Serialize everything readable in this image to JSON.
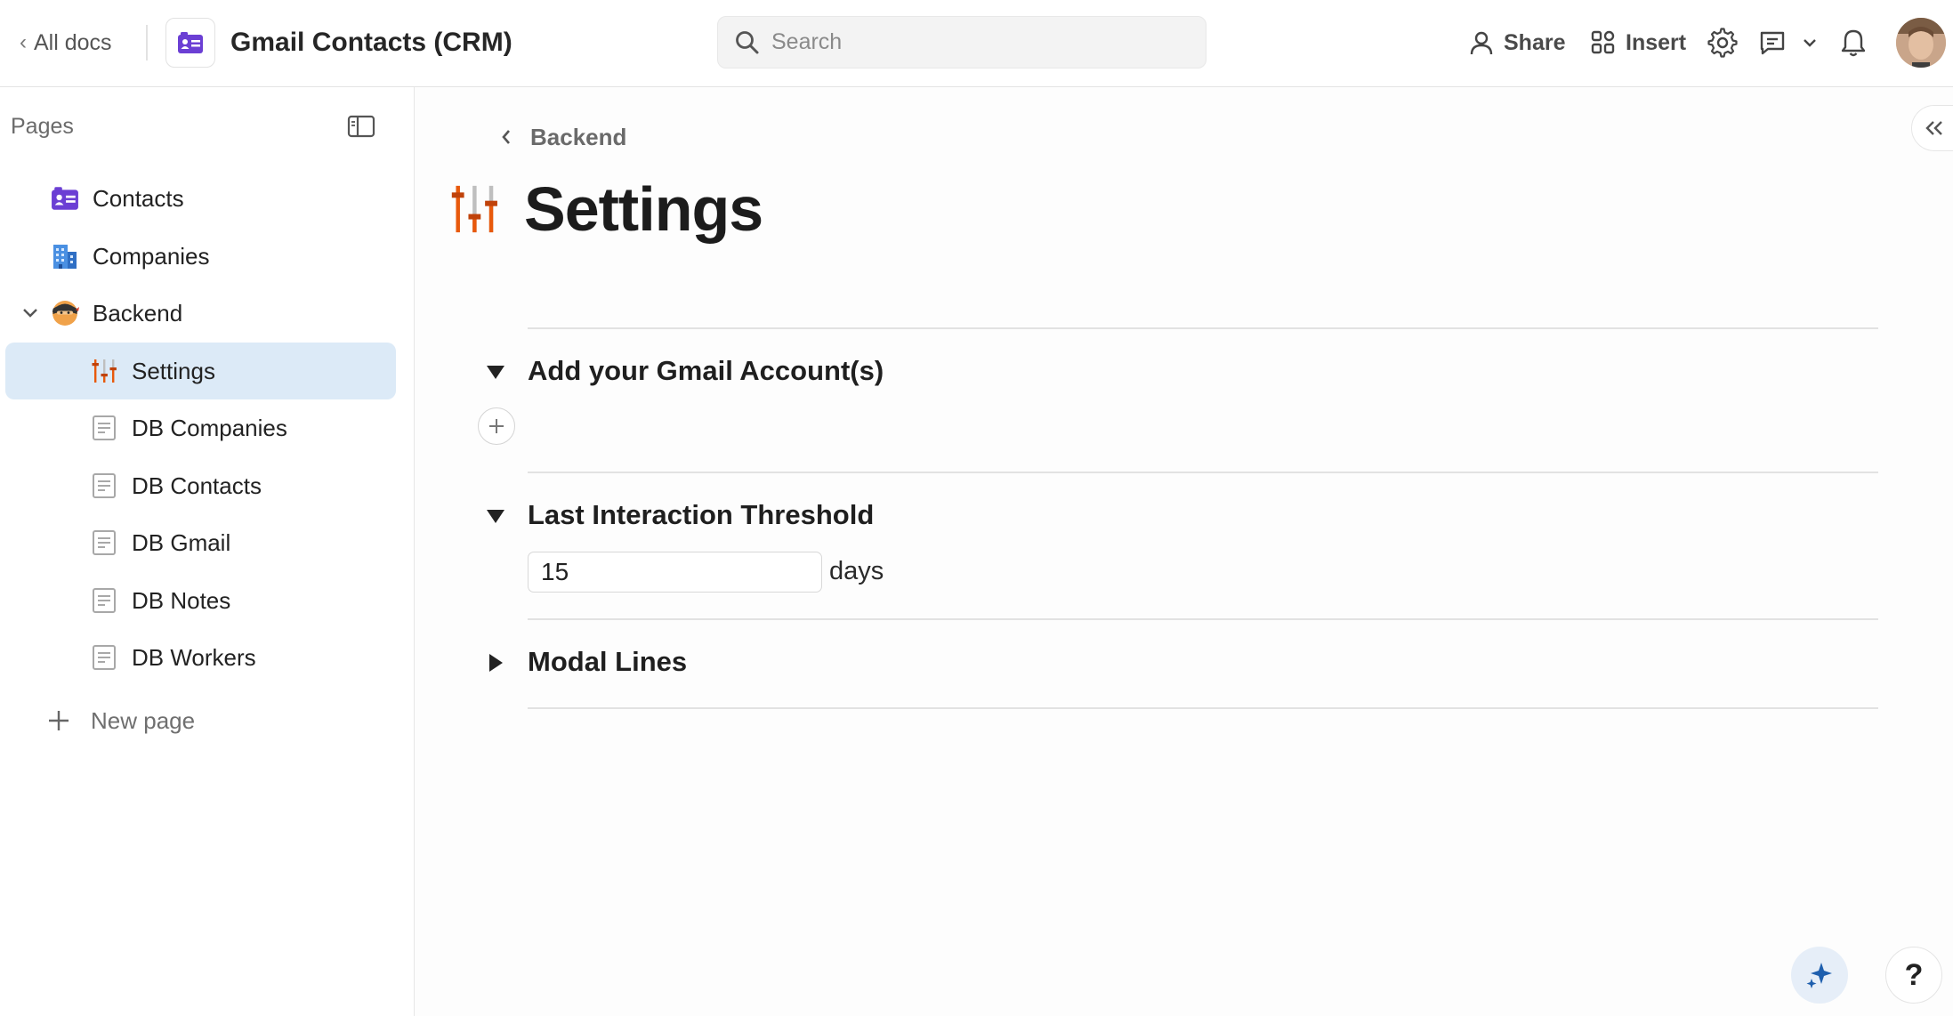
{
  "header": {
    "back_label": "All docs",
    "doc_title": "Gmail Contacts (CRM)",
    "search_placeholder": "Search",
    "share_label": "Share",
    "insert_label": "Insert"
  },
  "sidebar": {
    "heading": "Pages",
    "items": [
      {
        "label": "Contacts",
        "icon": "contacts-card-icon"
      },
      {
        "label": "Companies",
        "icon": "building-icon"
      },
      {
        "label": "Backend",
        "icon": "ninja-icon"
      },
      {
        "label": "Settings",
        "icon": "sliders-icon",
        "active": true
      },
      {
        "label": "DB Companies",
        "icon": "page-icon"
      },
      {
        "label": "DB Contacts",
        "icon": "page-icon"
      },
      {
        "label": "DB Gmail",
        "icon": "page-icon"
      },
      {
        "label": "DB Notes",
        "icon": "page-icon"
      },
      {
        "label": "DB Workers",
        "icon": "page-icon"
      }
    ],
    "new_page_label": "New page"
  },
  "main": {
    "breadcrumb": "Backend",
    "title": "Settings",
    "sections": [
      {
        "title": "Add your Gmail Account(s)",
        "expanded": true
      },
      {
        "title": "Last Interaction Threshold",
        "expanded": true,
        "value": "15",
        "unit": "days"
      },
      {
        "title": "Modal Lines",
        "expanded": false
      }
    ],
    "help_label": "?"
  },
  "colors": {
    "accent_active_bg": "#dceaf7",
    "brand_purple": "#6b3fd4",
    "settings_orange": "#e8590c"
  }
}
